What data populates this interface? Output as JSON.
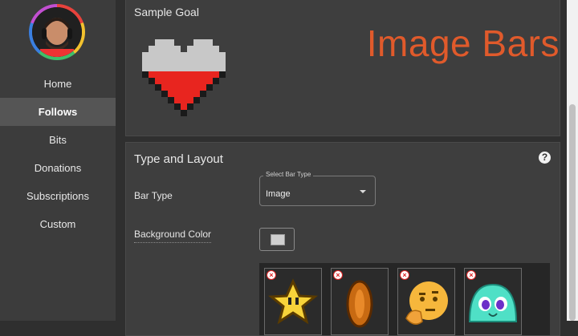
{
  "sidebar": {
    "items": [
      {
        "label": "Home",
        "active": false
      },
      {
        "label": "Follows",
        "active": true
      },
      {
        "label": "Bits",
        "active": false
      },
      {
        "label": "Donations",
        "active": false
      },
      {
        "label": "Subscriptions",
        "active": false
      },
      {
        "label": "Custom",
        "active": false
      }
    ]
  },
  "preview": {
    "sample_title": "Sample Goal",
    "overlay_title": "Image Bars",
    "goal_progress": 0.55
  },
  "type_layout": {
    "title": "Type and Layout",
    "bar_type_label": "Bar Type",
    "bar_type_legend": "Select Bar Type",
    "bar_type_value": "Image",
    "background_color_label": "Background Color",
    "background_color": "#cfcfcf",
    "images": [
      {
        "name": "star-image"
      },
      {
        "name": "coin-image"
      },
      {
        "name": "thinking-emoji-image"
      },
      {
        "name": "slime-image"
      }
    ]
  },
  "colors": {
    "accent": "#e05a2b",
    "heart_fill": "#e8251f",
    "heart_empty": "#c8c8c8"
  }
}
